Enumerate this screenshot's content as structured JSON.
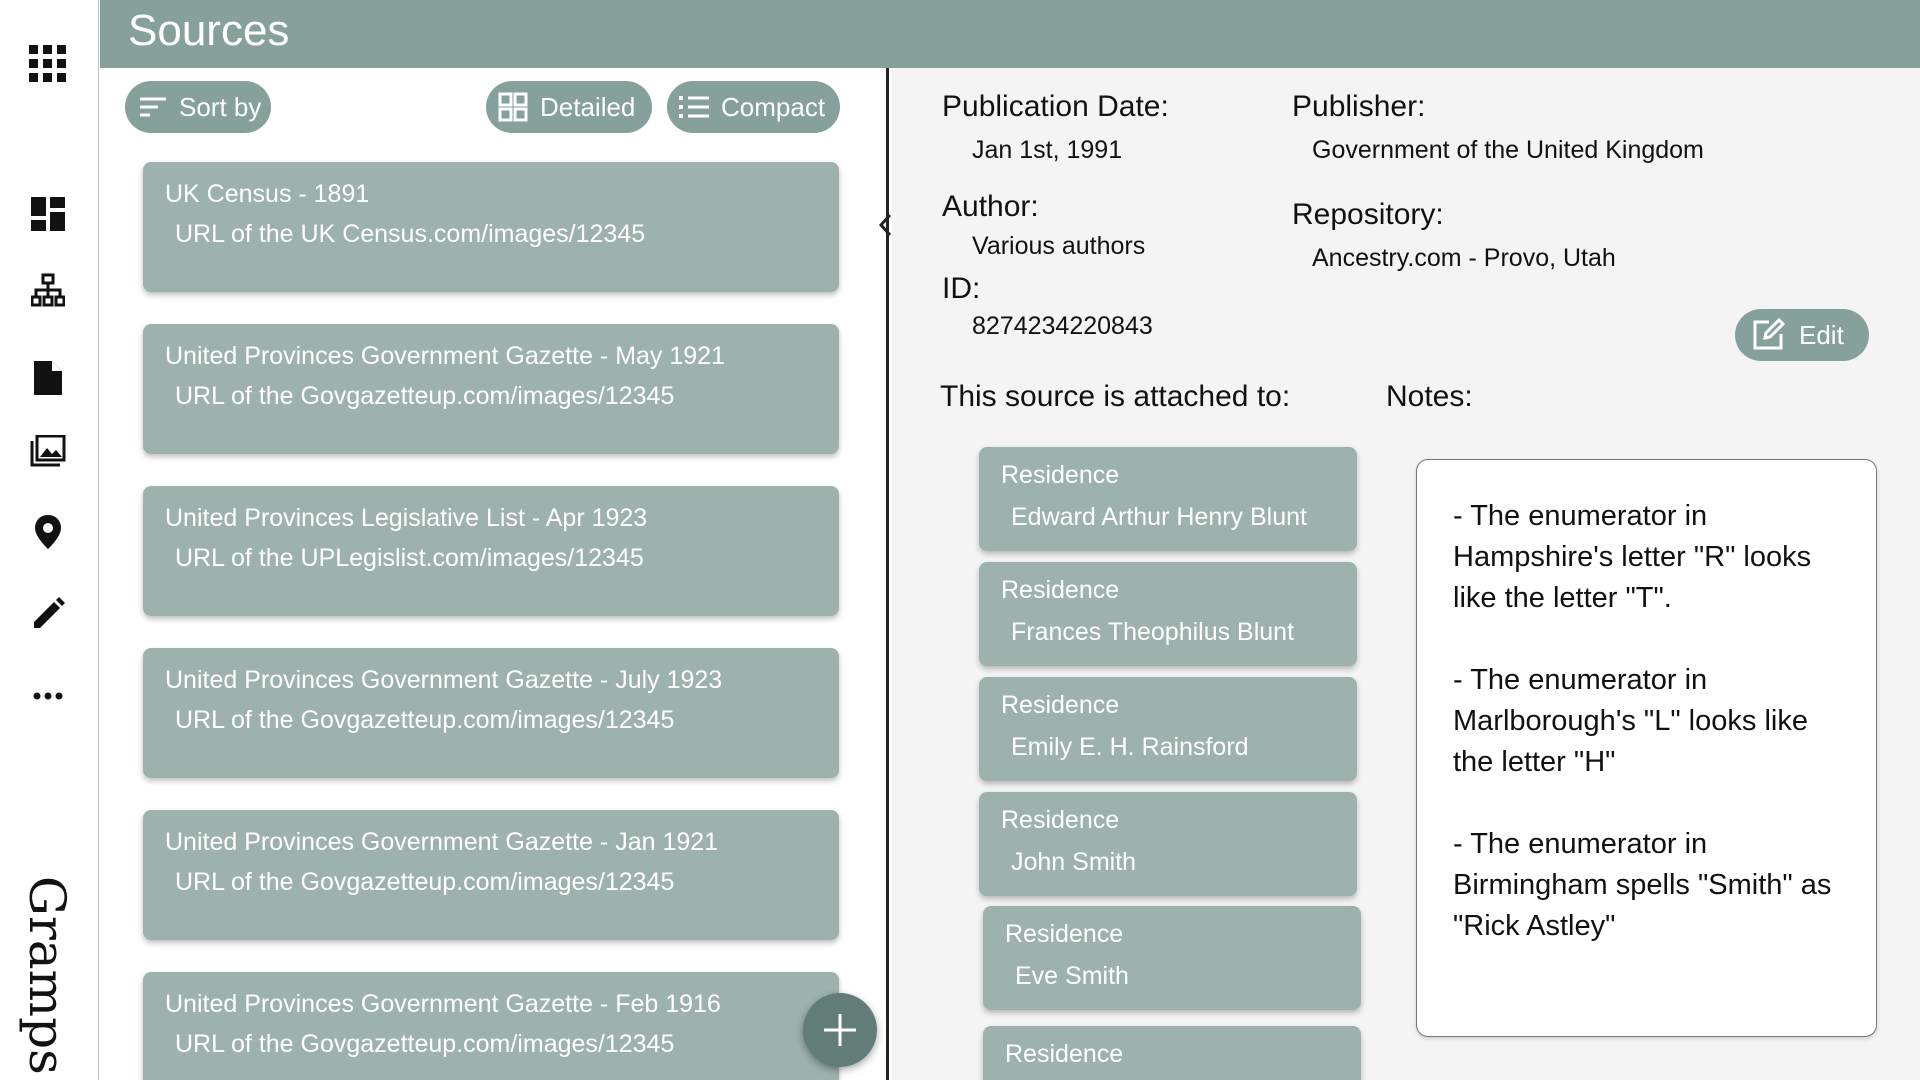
{
  "app": {
    "brand": "Gramps"
  },
  "nav": {
    "items": [
      {
        "name": "apps",
        "icon": "apps-grid-icon"
      },
      {
        "name": "dashboard",
        "icon": "dashboard-icon"
      },
      {
        "name": "family-tree",
        "icon": "tree-icon"
      },
      {
        "name": "sources",
        "icon": "file-icon"
      },
      {
        "name": "media",
        "icon": "photo-library-icon"
      },
      {
        "name": "places",
        "icon": "location-pin-icon"
      },
      {
        "name": "edit",
        "icon": "pencil-icon"
      },
      {
        "name": "more",
        "icon": "more-horizontal-icon"
      }
    ]
  },
  "header": {
    "title": "Sources"
  },
  "toolbar": {
    "sort_label": "Sort by",
    "detailed_label": "Detailed",
    "compact_label": "Compact"
  },
  "sources": [
    {
      "title": "UK Census - 1891",
      "url": "URL of the UK Census.com/images/12345"
    },
    {
      "title": "United Provinces Government Gazette - May 1921",
      "url": "URL of the Govgazetteup.com/images/12345"
    },
    {
      "title": "United Provinces Legislative List - Apr 1923",
      "url": "URL of the UPLegislist.com/images/12345"
    },
    {
      "title": "United Provinces Government Gazette - July 1923",
      "url": "URL of the Govgazetteup.com/images/12345"
    },
    {
      "title": "United Provinces Government Gazette - Jan 1921",
      "url": "URL of the Govgazetteup.com/images/12345"
    },
    {
      "title": "United Provinces Government Gazette - Feb 1916",
      "url": "URL of the Govgazetteup.com/images/12345"
    }
  ],
  "detail": {
    "publication_date_label": "Publication Date:",
    "publication_date": "Jan 1st, 1991",
    "publisher_label": "Publisher:",
    "publisher": "Government of the United Kingdom",
    "author_label": "Author:",
    "author": "Various authors",
    "repository_label": "Repository:",
    "repository": "Ancestry.com - Provo, Utah",
    "id_label": "ID:",
    "id": "8274234220843",
    "edit_label": "Edit",
    "attached_label": "This source is attached to:",
    "notes_label": "Notes:",
    "attached": [
      {
        "type": "Residence",
        "name": "Edward Arthur Henry Blunt"
      },
      {
        "type": "Residence",
        "name": "Frances Theophilus Blunt"
      },
      {
        "type": "Residence",
        "name": "Emily E. H. Rainsford"
      },
      {
        "type": "Residence",
        "name": "John Smith"
      },
      {
        "type": "Residence",
        "name": "Eve Smith"
      },
      {
        "type": "Residence",
        "name": ""
      }
    ],
    "notes": [
      "- The enumerator in Hampshire's letter \"R\" looks like the letter \"T\".",
      "- The enumerator in Marlborough's \"L\" looks like the letter \"H\"",
      "- The enumerator in Birmingham spells \"Smith\" as \"Rick Astley\""
    ]
  },
  "colors": {
    "header": "#86a19b",
    "card": "#9db2ad",
    "fab": "#627d78"
  }
}
